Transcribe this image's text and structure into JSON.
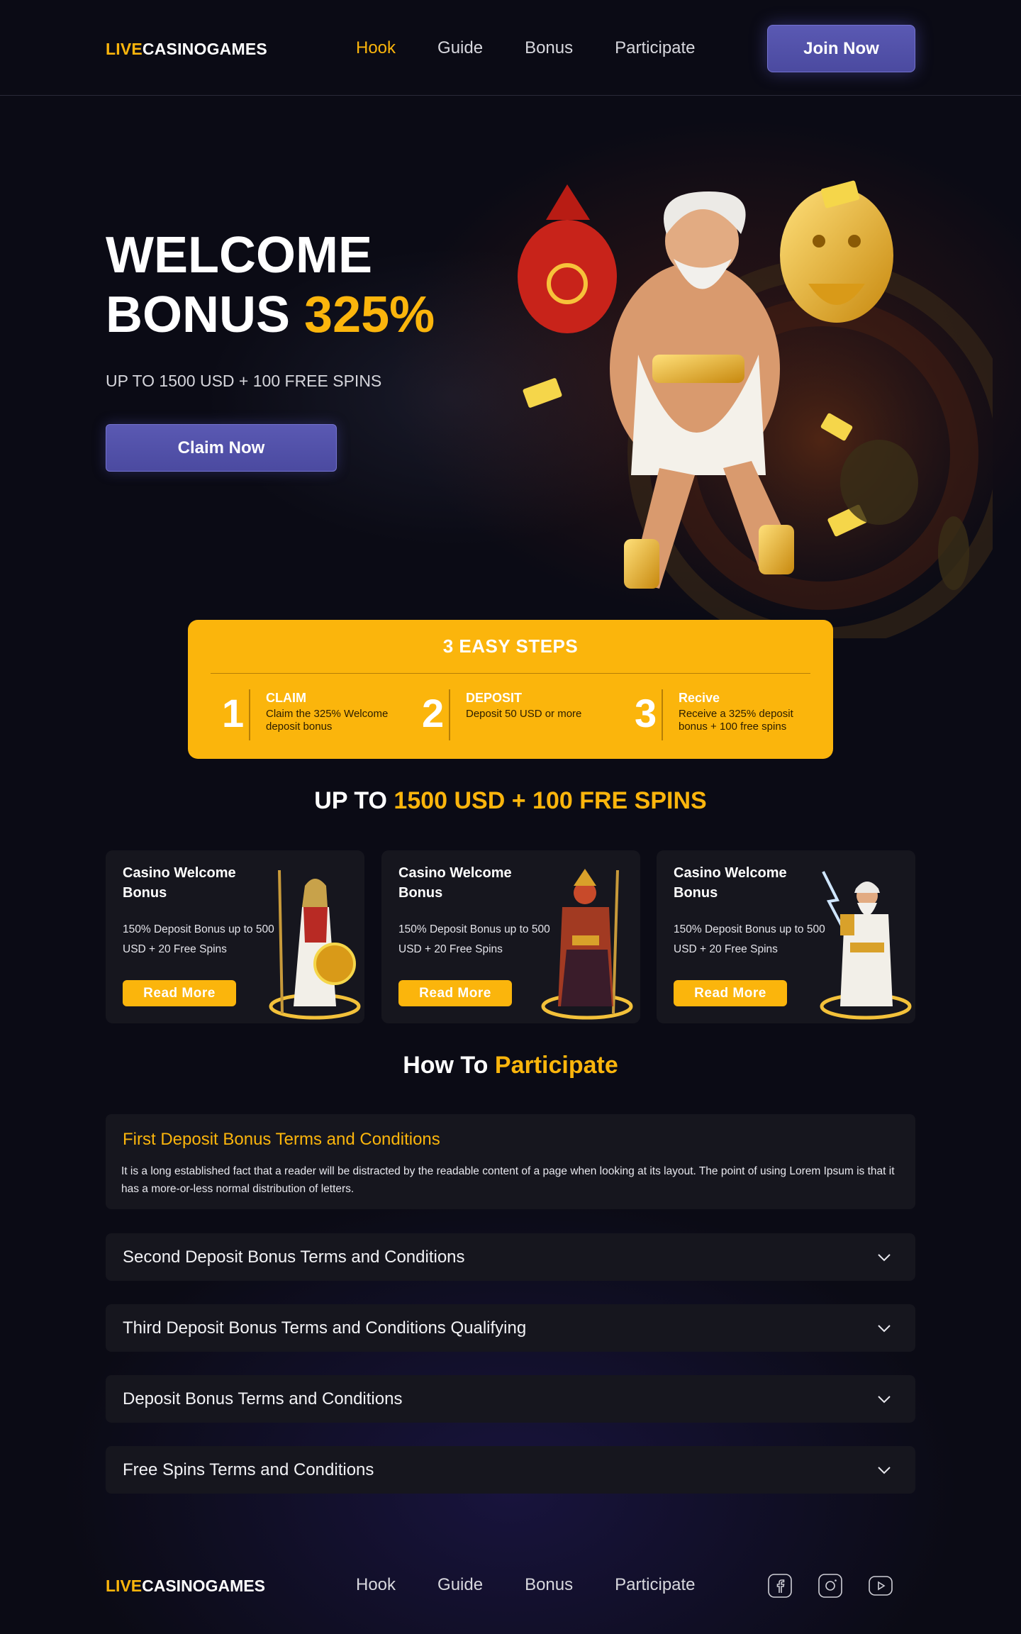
{
  "header": {
    "logo_part1": "LIVE",
    "logo_part2": "CASINOGAMES",
    "nav": [
      {
        "label": "Hook",
        "active": true
      },
      {
        "label": "Guide"
      },
      {
        "label": "Bonus"
      },
      {
        "label": "Participate"
      }
    ],
    "join_label": "Join Now"
  },
  "hero": {
    "title_line1": "WELCOME",
    "title_line2": "BONUS",
    "title_highlight": "325%",
    "subtitle": "UP TO 1500 USD + 100 FREE SPINS",
    "claim_label": "Claim Now"
  },
  "steps": {
    "title": "3 EASY STEPS",
    "items": [
      {
        "num": "1",
        "title": "CLAIM",
        "desc": "Claim the 325% Welcome deposit bonus"
      },
      {
        "num": "2",
        "title": "DEPOSIT",
        "desc": "Deposit 50 USD or more"
      },
      {
        "num": "3",
        "title": "Recive",
        "desc": "Receive a 325% deposit bonus + 100 free spins"
      }
    ]
  },
  "offer": {
    "prefix": "UP TO ",
    "highlight": "1500 USD + 100 FRE SPINS"
  },
  "cards": [
    {
      "title": "Casino Welcome Bonus",
      "desc": "150% Deposit Bonus up to 500 USD + 20 Free Spins",
      "button": "Read  More",
      "character": "warrior-goddess"
    },
    {
      "title": "Casino Welcome Bonus",
      "desc": "150% Deposit Bonus up to 500 USD + 20 Free Spins",
      "button": "Read  More",
      "character": "fire-demon-king"
    },
    {
      "title": "Casino Welcome Bonus",
      "desc": "150% Deposit Bonus up to 500 USD + 20 Free Spins",
      "button": "Read  More",
      "character": "lightning-god"
    }
  ],
  "participate": {
    "title_prefix": "How To ",
    "title_highlight": "Participate",
    "open_item": {
      "title": "First Deposit Bonus Terms and Conditions",
      "body": "It is a long established fact that a reader will be distracted by the readable content of a page when looking at its layout. The point of using Lorem Ipsum is that it has a more-or-less normal distribution of letters."
    },
    "items": [
      "Second Deposit Bonus Terms and Conditions",
      "Third Deposit Bonus Terms and Conditions Qualifying",
      "Deposit Bonus Terms and Conditions",
      "Free Spins Terms and Conditions"
    ]
  },
  "footer": {
    "logo_part1": "LIVE",
    "logo_part2": "CASINOGAMES",
    "nav": [
      "Hook",
      "Guide",
      "Bonus",
      "Participate"
    ],
    "social": [
      "facebook-icon",
      "instagram-icon",
      "youtube-icon"
    ]
  },
  "colors": {
    "accent": "#fbb50c",
    "button": "#5a59b3",
    "background": "#0b0b15",
    "card": "#16161e"
  }
}
